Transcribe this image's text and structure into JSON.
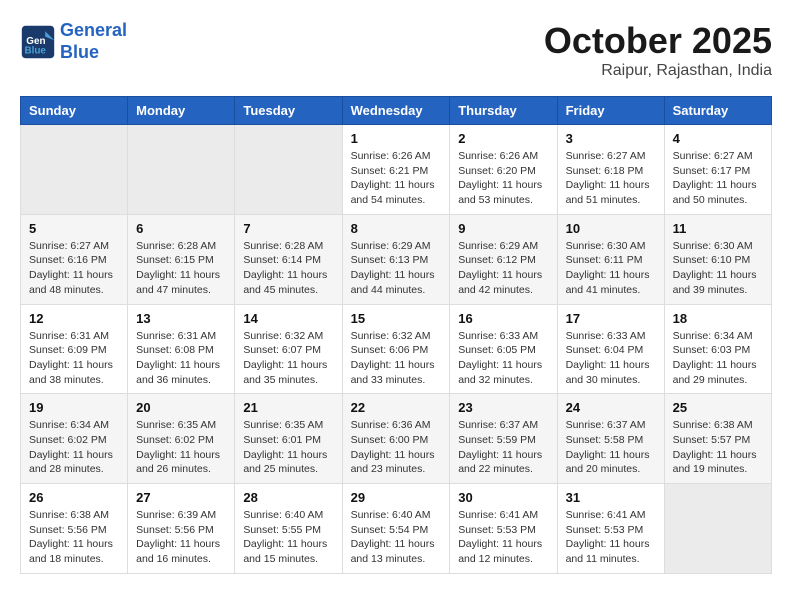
{
  "header": {
    "logo_line1": "General",
    "logo_line2": "Blue",
    "month": "October 2025",
    "location": "Raipur, Rajasthan, India"
  },
  "weekdays": [
    "Sunday",
    "Monday",
    "Tuesday",
    "Wednesday",
    "Thursday",
    "Friday",
    "Saturday"
  ],
  "weeks": [
    [
      {
        "day": "",
        "info": ""
      },
      {
        "day": "",
        "info": ""
      },
      {
        "day": "",
        "info": ""
      },
      {
        "day": "1",
        "info": "Sunrise: 6:26 AM\nSunset: 6:21 PM\nDaylight: 11 hours\nand 54 minutes."
      },
      {
        "day": "2",
        "info": "Sunrise: 6:26 AM\nSunset: 6:20 PM\nDaylight: 11 hours\nand 53 minutes."
      },
      {
        "day": "3",
        "info": "Sunrise: 6:27 AM\nSunset: 6:18 PM\nDaylight: 11 hours\nand 51 minutes."
      },
      {
        "day": "4",
        "info": "Sunrise: 6:27 AM\nSunset: 6:17 PM\nDaylight: 11 hours\nand 50 minutes."
      }
    ],
    [
      {
        "day": "5",
        "info": "Sunrise: 6:27 AM\nSunset: 6:16 PM\nDaylight: 11 hours\nand 48 minutes."
      },
      {
        "day": "6",
        "info": "Sunrise: 6:28 AM\nSunset: 6:15 PM\nDaylight: 11 hours\nand 47 minutes."
      },
      {
        "day": "7",
        "info": "Sunrise: 6:28 AM\nSunset: 6:14 PM\nDaylight: 11 hours\nand 45 minutes."
      },
      {
        "day": "8",
        "info": "Sunrise: 6:29 AM\nSunset: 6:13 PM\nDaylight: 11 hours\nand 44 minutes."
      },
      {
        "day": "9",
        "info": "Sunrise: 6:29 AM\nSunset: 6:12 PM\nDaylight: 11 hours\nand 42 minutes."
      },
      {
        "day": "10",
        "info": "Sunrise: 6:30 AM\nSunset: 6:11 PM\nDaylight: 11 hours\nand 41 minutes."
      },
      {
        "day": "11",
        "info": "Sunrise: 6:30 AM\nSunset: 6:10 PM\nDaylight: 11 hours\nand 39 minutes."
      }
    ],
    [
      {
        "day": "12",
        "info": "Sunrise: 6:31 AM\nSunset: 6:09 PM\nDaylight: 11 hours\nand 38 minutes."
      },
      {
        "day": "13",
        "info": "Sunrise: 6:31 AM\nSunset: 6:08 PM\nDaylight: 11 hours\nand 36 minutes."
      },
      {
        "day": "14",
        "info": "Sunrise: 6:32 AM\nSunset: 6:07 PM\nDaylight: 11 hours\nand 35 minutes."
      },
      {
        "day": "15",
        "info": "Sunrise: 6:32 AM\nSunset: 6:06 PM\nDaylight: 11 hours\nand 33 minutes."
      },
      {
        "day": "16",
        "info": "Sunrise: 6:33 AM\nSunset: 6:05 PM\nDaylight: 11 hours\nand 32 minutes."
      },
      {
        "day": "17",
        "info": "Sunrise: 6:33 AM\nSunset: 6:04 PM\nDaylight: 11 hours\nand 30 minutes."
      },
      {
        "day": "18",
        "info": "Sunrise: 6:34 AM\nSunset: 6:03 PM\nDaylight: 11 hours\nand 29 minutes."
      }
    ],
    [
      {
        "day": "19",
        "info": "Sunrise: 6:34 AM\nSunset: 6:02 PM\nDaylight: 11 hours\nand 28 minutes."
      },
      {
        "day": "20",
        "info": "Sunrise: 6:35 AM\nSunset: 6:02 PM\nDaylight: 11 hours\nand 26 minutes."
      },
      {
        "day": "21",
        "info": "Sunrise: 6:35 AM\nSunset: 6:01 PM\nDaylight: 11 hours\nand 25 minutes."
      },
      {
        "day": "22",
        "info": "Sunrise: 6:36 AM\nSunset: 6:00 PM\nDaylight: 11 hours\nand 23 minutes."
      },
      {
        "day": "23",
        "info": "Sunrise: 6:37 AM\nSunset: 5:59 PM\nDaylight: 11 hours\nand 22 minutes."
      },
      {
        "day": "24",
        "info": "Sunrise: 6:37 AM\nSunset: 5:58 PM\nDaylight: 11 hours\nand 20 minutes."
      },
      {
        "day": "25",
        "info": "Sunrise: 6:38 AM\nSunset: 5:57 PM\nDaylight: 11 hours\nand 19 minutes."
      }
    ],
    [
      {
        "day": "26",
        "info": "Sunrise: 6:38 AM\nSunset: 5:56 PM\nDaylight: 11 hours\nand 18 minutes."
      },
      {
        "day": "27",
        "info": "Sunrise: 6:39 AM\nSunset: 5:56 PM\nDaylight: 11 hours\nand 16 minutes."
      },
      {
        "day": "28",
        "info": "Sunrise: 6:40 AM\nSunset: 5:55 PM\nDaylight: 11 hours\nand 15 minutes."
      },
      {
        "day": "29",
        "info": "Sunrise: 6:40 AM\nSunset: 5:54 PM\nDaylight: 11 hours\nand 13 minutes."
      },
      {
        "day": "30",
        "info": "Sunrise: 6:41 AM\nSunset: 5:53 PM\nDaylight: 11 hours\nand 12 minutes."
      },
      {
        "day": "31",
        "info": "Sunrise: 6:41 AM\nSunset: 5:53 PM\nDaylight: 11 hours\nand 11 minutes."
      },
      {
        "day": "",
        "info": ""
      }
    ]
  ]
}
